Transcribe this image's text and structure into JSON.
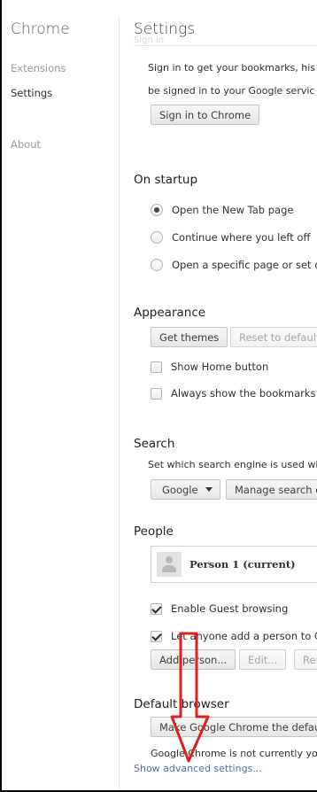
{
  "sidebar": {
    "title": "Chrome",
    "items": [
      {
        "label": "Extensions"
      },
      {
        "label": "Settings"
      },
      {
        "label": "About"
      }
    ]
  },
  "header": {
    "title": "Settings",
    "ghost_text": "Sign in"
  },
  "sign_in": {
    "line1": "Sign in to get your bookmarks, his",
    "line2": "be signed in to your Google servic",
    "button": "Sign in to Chrome"
  },
  "on_startup": {
    "heading": "On startup",
    "options": [
      {
        "label": "Open the New Tab page",
        "selected": true
      },
      {
        "label": "Continue where you left off",
        "selected": false
      },
      {
        "label": "Open a specific page or set of",
        "selected": false
      }
    ]
  },
  "appearance": {
    "heading": "Appearance",
    "get_themes": "Get themes",
    "reset": "Reset to default",
    "show_home": "Show Home button",
    "show_bookmarks": "Always show the bookmarks b"
  },
  "search": {
    "heading": "Search",
    "description": "Set which search engine is used wl",
    "engine": "Google",
    "manage": "Manage search e"
  },
  "people": {
    "heading": "People",
    "person": "Person 1 (current)",
    "guest": "Enable Guest browsing",
    "anyone_add": "Let anyone add a person to Ch",
    "add_person": "Add person...",
    "edit": "Edit...",
    "remove": "Ren"
  },
  "default_browser": {
    "heading": "Default browser",
    "make_default": "Make Google Chrome the defau",
    "status": "Google Chrome is not currently yo"
  },
  "advanced_link": "Show advanced settings...",
  "colors": {
    "link": "#4a6fb5",
    "arrow": "#e02020"
  }
}
